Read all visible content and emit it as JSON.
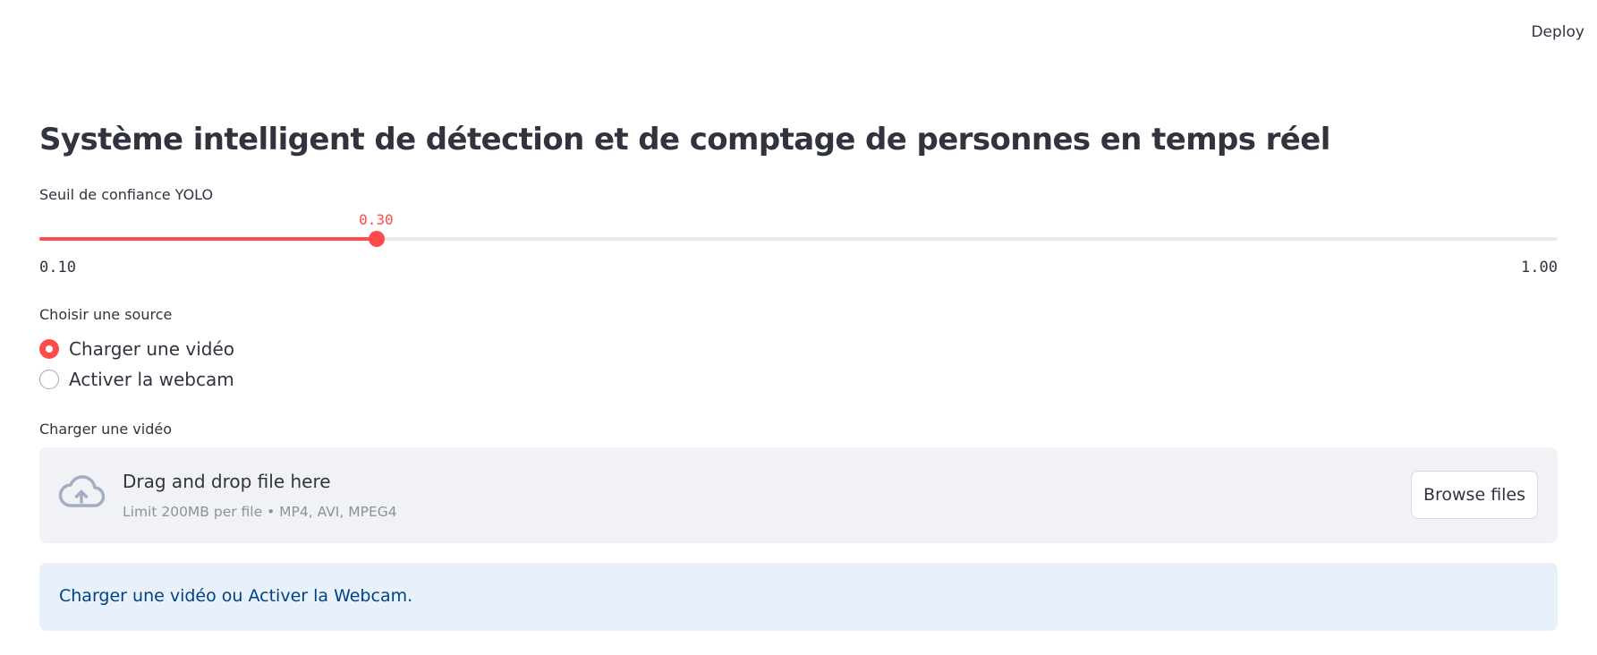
{
  "header": {
    "deploy_label": "Deploy"
  },
  "title": "Système intelligent de détection et de comptage de personnes en temps réel",
  "slider": {
    "label": "Seuil de confiance YOLO",
    "value": "0.30",
    "value_num": 0.3,
    "min": "0.10",
    "min_num": 0.1,
    "max": "1.00",
    "max_num": 1.0,
    "accent_color": "#ff4b4b"
  },
  "source": {
    "label": "Choisir une source",
    "options": [
      {
        "label": "Charger une vidéo",
        "selected": true
      },
      {
        "label": "Activer la webcam",
        "selected": false
      }
    ]
  },
  "uploader": {
    "label": "Charger une vidéo",
    "icon": "cloud-upload-icon",
    "title": "Drag and drop file here",
    "subtitle": "Limit 200MB per file • MP4, AVI, MPEG4",
    "browse_label": "Browse files"
  },
  "info": {
    "text": "Charger une vidéo ou Activer la Webcam.",
    "bg_color": "#e8f1fb",
    "text_color": "#004280"
  }
}
